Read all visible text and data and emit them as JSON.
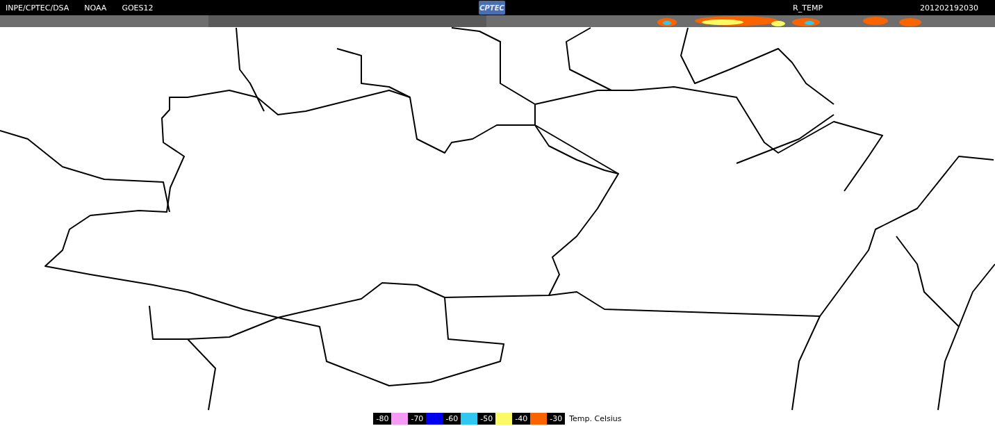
{
  "header": {
    "left_labels": [
      "INPE/CPTEC/DSA",
      "NOAA",
      "GOES12"
    ],
    "logo": "CPTEC",
    "product": "R_TEMP",
    "timestamp": "201202192030"
  },
  "legend": {
    "items": [
      {
        "label": "-80",
        "color": "#f59af5"
      },
      {
        "label": "-70",
        "color": "#0000f0"
      },
      {
        "label": "-60",
        "color": "#30c8f0"
      },
      {
        "label": "-50",
        "color": "#fafa64"
      },
      {
        "label": "-40",
        "color": "#fa6400"
      },
      {
        "label": "-30"
      }
    ],
    "unit": "Temp. Celsius"
  }
}
